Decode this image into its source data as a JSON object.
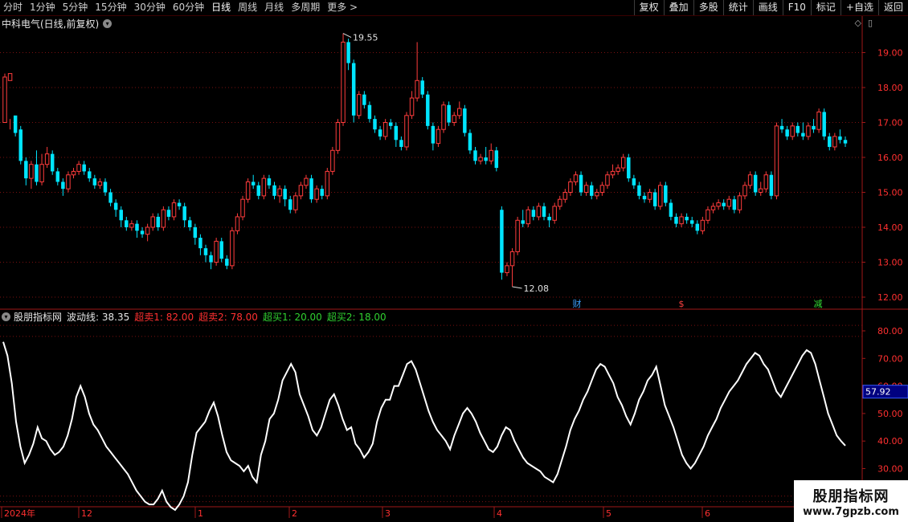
{
  "toolbar": {
    "tabs": [
      "分时",
      "1分钟",
      "5分钟",
      "15分钟",
      "30分钟",
      "60分钟",
      "日线",
      "周线",
      "月线",
      "多周期",
      "更多 >"
    ],
    "active_tab": "日线",
    "tools": [
      "复权",
      "叠加",
      "多股",
      "统计",
      "画线",
      "F10",
      "标记",
      "+自选",
      "返回"
    ]
  },
  "stock": {
    "title": "中科电气(日线,前复权)"
  },
  "price_axis": {
    "ticks": [
      "19.00",
      "18.00",
      "17.00",
      "16.00",
      "15.00",
      "14.00",
      "13.00",
      "12.00"
    ]
  },
  "annotations": {
    "high": "19.55",
    "low": "12.08",
    "markers": [
      "财",
      "$",
      "减"
    ]
  },
  "indicator": {
    "name": "股朋指标网",
    "line_label": "波动线: 38.35",
    "sell1": "超卖1: 82.00",
    "sell2": "超卖2: 78.00",
    "buy1": "超买1: 20.00",
    "buy2": "超买2: 18.00",
    "ticks": [
      "80.00",
      "70.00",
      "60.00",
      "50.00",
      "40.00",
      "30.00"
    ],
    "current_value": "57.92"
  },
  "date_axis": {
    "labels": [
      "2024年",
      "12",
      "1",
      "2",
      "3",
      "4",
      "5",
      "6"
    ]
  },
  "watermark": {
    "line1": "股朋指标网",
    "line2": "www.7gpzb.com"
  },
  "colors": {
    "up": "#ff3c3c",
    "down": "#00e5ff",
    "line": "#ffffff",
    "grid": "#7a1010",
    "axis": "#a01818",
    "label_red": "#ff3030",
    "label_green": "#30d030"
  },
  "chart_data": [
    {
      "type": "candlestick",
      "title": "中科电气(日线,前复权)",
      "ylim": [
        11.8,
        19.7
      ],
      "note": "OHLC values estimated from the price axis",
      "candles": [
        [
          17.0,
          18.3,
          17.2,
          18.4
        ],
        [
          18.2,
          18.4,
          16.8,
          17.1
        ],
        [
          17.2,
          16.7,
          16.6,
          17.1
        ],
        [
          16.8,
          15.9,
          15.8,
          16.9
        ],
        [
          15.9,
          15.4,
          15.2,
          16.0
        ],
        [
          15.4,
          15.8,
          15.1,
          15.9
        ],
        [
          15.8,
          15.3,
          15.2,
          16.2
        ],
        [
          15.3,
          15.8,
          15.2,
          16.1
        ],
        [
          15.8,
          16.1,
          15.7,
          16.3
        ],
        [
          16.1,
          15.6,
          15.5,
          16.2
        ],
        [
          15.6,
          15.3,
          15.2,
          15.7
        ],
        [
          15.3,
          15.1,
          14.9,
          15.4
        ],
        [
          15.1,
          15.5,
          15.0,
          15.6
        ],
        [
          15.5,
          15.6,
          15.4,
          15.7
        ],
        [
          15.6,
          15.8,
          15.5,
          15.9
        ],
        [
          15.8,
          15.6,
          15.5,
          15.9
        ],
        [
          15.6,
          15.4,
          15.3,
          15.7
        ],
        [
          15.4,
          15.2,
          15.1,
          15.5
        ],
        [
          15.2,
          15.3,
          15.1,
          15.4
        ],
        [
          15.3,
          15.0,
          14.9,
          15.4
        ],
        [
          15.0,
          14.7,
          14.6,
          15.1
        ],
        [
          14.7,
          14.5,
          14.3,
          14.8
        ],
        [
          14.5,
          14.2,
          14.0,
          14.6
        ],
        [
          14.2,
          14.0,
          13.9,
          14.3
        ],
        [
          14.0,
          14.1,
          13.9,
          14.2
        ],
        [
          14.1,
          13.9,
          13.7,
          14.2
        ],
        [
          13.9,
          13.8,
          13.7,
          14.0
        ],
        [
          13.8,
          14.0,
          13.6,
          14.1
        ],
        [
          14.0,
          14.3,
          13.9,
          14.4
        ],
        [
          14.3,
          14.0,
          13.9,
          14.4
        ],
        [
          14.0,
          14.5,
          13.9,
          14.6
        ],
        [
          14.5,
          14.3,
          14.2,
          14.6
        ],
        [
          14.3,
          14.7,
          14.2,
          14.8
        ],
        [
          14.7,
          14.6,
          14.5,
          14.8
        ],
        [
          14.6,
          14.2,
          14.0,
          14.7
        ],
        [
          14.2,
          14.0,
          13.9,
          14.3
        ],
        [
          14.0,
          13.7,
          13.5,
          14.1
        ],
        [
          13.7,
          13.4,
          13.2,
          13.8
        ],
        [
          13.4,
          13.2,
          13.0,
          13.5
        ],
        [
          13.2,
          13.0,
          12.8,
          13.3
        ],
        [
          13.0,
          13.6,
          12.9,
          13.7
        ],
        [
          13.6,
          13.1,
          13.0,
          13.7
        ],
        [
          13.1,
          12.9,
          12.8,
          13.2
        ],
        [
          12.9,
          13.9,
          12.8,
          14.0
        ],
        [
          13.9,
          14.3,
          13.8,
          14.4
        ],
        [
          14.3,
          14.8,
          14.2,
          14.9
        ],
        [
          14.8,
          15.3,
          14.7,
          15.4
        ],
        [
          15.3,
          15.2,
          15.1,
          15.5
        ],
        [
          15.2,
          14.9,
          14.8,
          15.3
        ],
        [
          14.9,
          15.4,
          14.8,
          15.5
        ],
        [
          15.4,
          15.2,
          15.1,
          15.5
        ],
        [
          15.2,
          14.9,
          14.8,
          15.3
        ],
        [
          14.9,
          15.1,
          14.7,
          15.2
        ],
        [
          15.1,
          14.8,
          14.6,
          15.2
        ],
        [
          14.8,
          14.5,
          14.4,
          14.9
        ],
        [
          14.5,
          14.9,
          14.4,
          15.0
        ],
        [
          14.9,
          15.2,
          14.8,
          15.3
        ],
        [
          15.2,
          15.4,
          15.1,
          15.5
        ],
        [
          15.4,
          14.8,
          14.7,
          15.5
        ],
        [
          14.8,
          15.1,
          14.7,
          15.2
        ],
        [
          15.1,
          14.9,
          14.8,
          15.2
        ],
        [
          14.9,
          15.6,
          14.8,
          15.7
        ],
        [
          15.6,
          16.2,
          15.5,
          16.3
        ],
        [
          16.2,
          17.0,
          16.1,
          17.1
        ],
        [
          17.0,
          19.3,
          16.9,
          19.55
        ],
        [
          19.3,
          18.7,
          18.5,
          19.4
        ],
        [
          18.7,
          17.2,
          17.0,
          18.8
        ],
        [
          17.2,
          17.8,
          17.1,
          17.9
        ],
        [
          17.8,
          17.5,
          17.4,
          17.9
        ],
        [
          17.5,
          17.1,
          17.0,
          17.6
        ],
        [
          17.1,
          16.8,
          16.7,
          17.2
        ],
        [
          16.8,
          16.6,
          16.5,
          16.9
        ],
        [
          16.6,
          17.0,
          16.5,
          17.1
        ],
        [
          17.0,
          16.9,
          16.8,
          17.1
        ],
        [
          16.9,
          16.5,
          16.3,
          17.0
        ],
        [
          16.5,
          16.3,
          16.2,
          16.6
        ],
        [
          16.3,
          17.2,
          16.2,
          17.3
        ],
        [
          17.2,
          17.7,
          17.1,
          17.9
        ],
        [
          17.7,
          18.2,
          17.6,
          19.3
        ],
        [
          18.2,
          17.8,
          17.7,
          18.3
        ],
        [
          17.8,
          16.9,
          16.8,
          17.9
        ],
        [
          16.9,
          16.4,
          16.2,
          17.0
        ],
        [
          16.4,
          16.8,
          16.3,
          16.9
        ],
        [
          16.8,
          17.5,
          16.7,
          17.6
        ],
        [
          17.5,
          17.0,
          16.9,
          17.6
        ],
        [
          17.0,
          17.2,
          16.9,
          17.3
        ],
        [
          17.2,
          17.4,
          17.1,
          17.6
        ],
        [
          17.4,
          16.7,
          16.6,
          17.5
        ],
        [
          16.7,
          16.2,
          16.1,
          16.8
        ],
        [
          16.2,
          15.9,
          15.8,
          16.3
        ],
        [
          15.9,
          16.0,
          15.8,
          16.1
        ],
        [
          16.0,
          15.9,
          15.8,
          16.3
        ],
        [
          15.9,
          16.2,
          15.8,
          16.4
        ],
        [
          16.2,
          15.7,
          15.6,
          16.3
        ],
        [
          14.5,
          12.7,
          12.5,
          14.6
        ],
        [
          12.7,
          12.9,
          12.6,
          13.0
        ],
        [
          12.9,
          13.3,
          12.3,
          13.4
        ],
        [
          13.3,
          14.2,
          13.2,
          14.3
        ],
        [
          14.2,
          14.1,
          14.0,
          14.5
        ],
        [
          14.1,
          14.5,
          14.0,
          14.6
        ],
        [
          14.5,
          14.3,
          14.2,
          14.6
        ],
        [
          14.3,
          14.6,
          14.2,
          14.7
        ],
        [
          14.6,
          14.3,
          14.2,
          14.7
        ],
        [
          14.3,
          14.2,
          14.0,
          14.4
        ],
        [
          14.2,
          14.6,
          14.1,
          14.7
        ],
        [
          14.6,
          14.8,
          14.5,
          14.9
        ],
        [
          14.8,
          15.0,
          14.7,
          15.1
        ],
        [
          15.0,
          15.3,
          14.9,
          15.4
        ],
        [
          15.3,
          15.5,
          15.2,
          15.6
        ],
        [
          15.5,
          15.0,
          14.9,
          15.6
        ],
        [
          15.0,
          15.2,
          14.9,
          15.3
        ],
        [
          15.2,
          14.9,
          14.8,
          15.3
        ],
        [
          14.9,
          15.0,
          14.8,
          15.1
        ],
        [
          15.0,
          15.2,
          14.9,
          15.3
        ],
        [
          15.2,
          15.5,
          15.1,
          15.6
        ],
        [
          15.5,
          15.6,
          15.4,
          15.8
        ],
        [
          15.6,
          15.7,
          15.5,
          15.8
        ],
        [
          15.7,
          16.0,
          15.6,
          16.1
        ],
        [
          16.0,
          15.4,
          15.3,
          16.1
        ],
        [
          15.4,
          15.2,
          15.1,
          15.5
        ],
        [
          15.2,
          14.9,
          14.8,
          15.3
        ],
        [
          14.9,
          14.8,
          14.7,
          15.0
        ],
        [
          14.8,
          15.0,
          14.7,
          15.1
        ],
        [
          15.0,
          14.6,
          14.5,
          15.1
        ],
        [
          14.6,
          15.2,
          14.5,
          15.3
        ],
        [
          15.2,
          14.7,
          14.6,
          15.3
        ],
        [
          14.7,
          14.3,
          14.2,
          14.8
        ],
        [
          14.3,
          14.1,
          14.0,
          14.4
        ],
        [
          14.1,
          14.3,
          14.0,
          14.4
        ],
        [
          14.3,
          14.2,
          14.1,
          14.4
        ],
        [
          14.2,
          14.1,
          14.0,
          14.3
        ],
        [
          14.1,
          13.9,
          13.8,
          14.2
        ],
        [
          13.9,
          14.2,
          13.8,
          14.3
        ],
        [
          14.2,
          14.5,
          14.1,
          14.6
        ],
        [
          14.5,
          14.6,
          14.4,
          14.7
        ],
        [
          14.6,
          14.7,
          14.5,
          14.8
        ],
        [
          14.7,
          14.6,
          14.5,
          14.8
        ],
        [
          14.6,
          14.8,
          14.5,
          14.9
        ],
        [
          14.8,
          14.5,
          14.4,
          14.9
        ],
        [
          14.5,
          14.9,
          14.4,
          15.0
        ],
        [
          14.9,
          15.2,
          14.8,
          15.3
        ],
        [
          15.2,
          15.5,
          15.1,
          15.6
        ],
        [
          15.5,
          15.0,
          14.9,
          15.6
        ],
        [
          15.0,
          15.1,
          14.9,
          15.3
        ],
        [
          15.1,
          15.5,
          15.0,
          15.6
        ],
        [
          15.5,
          14.9,
          14.8,
          15.6
        ],
        [
          14.9,
          16.9,
          14.8,
          17.0
        ],
        [
          16.9,
          16.8,
          16.7,
          17.1
        ],
        [
          16.8,
          16.6,
          16.5,
          16.9
        ],
        [
          16.6,
          16.9,
          16.5,
          17.0
        ],
        [
          16.9,
          16.7,
          16.6,
          17.0
        ],
        [
          16.7,
          16.6,
          16.5,
          17.0
        ],
        [
          16.6,
          16.9,
          16.5,
          17.0
        ],
        [
          16.9,
          16.8,
          16.7,
          17.1
        ],
        [
          16.8,
          17.3,
          16.7,
          17.4
        ],
        [
          17.3,
          16.6,
          16.5,
          17.4
        ],
        [
          16.6,
          16.3,
          16.2,
          16.7
        ],
        [
          16.3,
          16.6,
          16.2,
          16.7
        ],
        [
          16.6,
          16.5,
          16.4,
          16.8
        ],
        [
          16.5,
          16.4,
          16.3,
          16.6
        ]
      ]
    },
    {
      "type": "line",
      "title": "股朋指标网",
      "ylim": [
        20,
        88
      ],
      "series": [
        {
          "name": "波动线",
          "values": [
            76,
            71,
            61,
            47,
            38,
            32,
            35,
            39,
            45,
            41,
            40,
            37,
            35,
            36,
            38,
            42,
            48,
            56,
            60,
            56,
            50,
            46,
            44,
            41,
            38,
            36,
            34,
            32,
            30,
            28,
            25,
            22,
            20,
            18,
            17,
            17,
            19,
            22,
            18,
            16,
            15,
            17,
            20,
            25,
            35,
            43,
            45,
            47,
            51,
            54,
            49,
            42,
            36,
            33,
            32,
            31,
            29,
            31,
            27,
            25,
            35,
            40,
            48,
            50,
            55,
            62,
            65,
            68,
            65,
            57,
            53,
            49,
            44,
            42,
            45,
            50,
            55,
            57,
            53,
            48,
            44,
            45,
            39,
            37,
            34,
            36,
            39,
            47,
            52,
            55,
            55,
            60,
            60,
            64,
            68,
            69,
            66,
            61,
            56,
            51,
            47,
            44,
            42,
            40,
            37,
            42,
            46,
            50,
            52,
            50,
            47,
            43,
            40,
            37,
            36,
            38,
            42,
            45,
            44,
            40,
            37,
            34,
            32,
            31,
            30,
            29,
            27,
            26,
            25,
            28,
            33,
            38,
            44,
            48,
            51,
            55,
            58,
            62,
            66,
            68,
            67,
            64,
            61,
            56,
            53,
            49,
            46,
            50,
            55,
            58,
            62,
            64,
            67,
            60,
            53,
            49,
            45,
            40,
            35,
            32,
            30,
            32,
            35,
            38,
            42,
            45,
            48,
            52,
            55,
            58,
            60,
            62,
            65,
            68,
            70,
            72,
            71,
            68,
            66,
            62,
            58,
            56,
            59,
            62,
            65,
            68,
            71,
            73,
            72,
            68,
            62,
            56,
            50,
            46,
            42,
            40,
            38.35
          ]
        }
      ]
    }
  ]
}
